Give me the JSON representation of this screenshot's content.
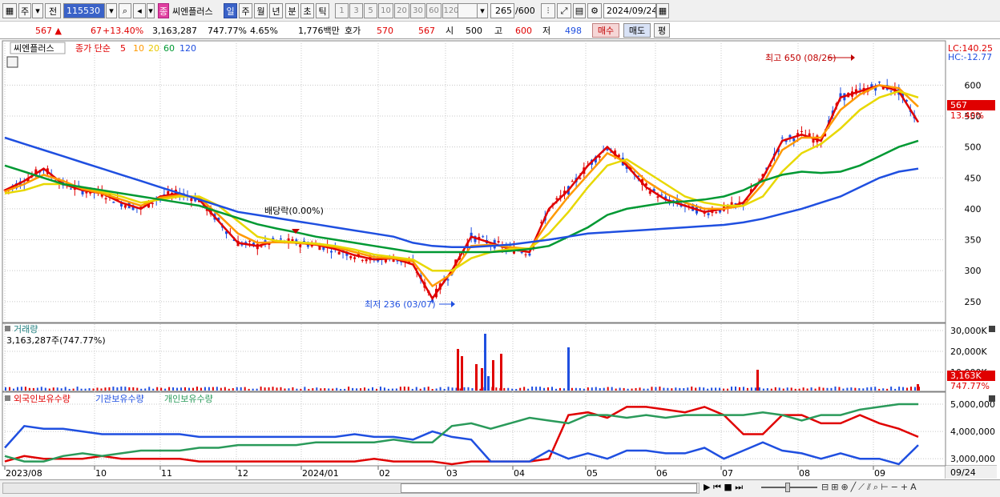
{
  "toolbar": {
    "market_btn": "주",
    "prev_btn": "전",
    "stock_code": "115530",
    "tag_label": "종",
    "stock_name": "씨엔플러스",
    "periods": [
      "일",
      "주",
      "월",
      "년",
      "분",
      "초",
      "틱"
    ],
    "active_period": "일",
    "minutes": [
      "1",
      "3",
      "5",
      "10",
      "20",
      "30",
      "60",
      "120"
    ],
    "count": "265",
    "count_total": "/600",
    "date": "2024/09/24"
  },
  "quote": {
    "price": "567",
    "change": "67",
    "change_pct": "+13.40%",
    "volume": "3,163,287",
    "vol_ratio": "747.77%",
    "turnover": "4.65%",
    "amount": "1,776백만",
    "hoga_label": "호가",
    "ask": "570",
    "bid": "567",
    "open_label": "시",
    "open": "500",
    "high_label": "고",
    "high": "600",
    "low_label": "저",
    "low": "498",
    "buy_btn": "매수",
    "sell_btn": "매도",
    "eval_btn": "평"
  },
  "price_panel": {
    "stock_tag": "씨엔플러스",
    "ma_label": "종가 단순",
    "ma_periods": [
      "5",
      "10",
      "20",
      "60",
      "120"
    ],
    "ma_colors": [
      "#e00000",
      "#ff9900",
      "#e8d800",
      "#009933",
      "#1f4fe0"
    ],
    "lc": "LC:140.25",
    "hc": "HC:-12.77",
    "cur_price_tag": "567",
    "cur_pct_tag": "13.40%",
    "high_note": "최고 650 (08/26)",
    "low_note": "최저 236 (03/07)",
    "dividend_note": "배당락(0.00%)",
    "y_ticks": [
      "600",
      "550",
      "500",
      "450",
      "400",
      "350",
      "300",
      "250"
    ]
  },
  "volume_panel": {
    "title": "거래량",
    "value": "3,163,287주(747.77%)",
    "y_ticks": [
      "30,000K",
      "20,000K",
      "10,000K"
    ],
    "cur_tag": "3,163K",
    "cur_pct": "747.77%"
  },
  "holdings_panel": {
    "legend": [
      "외국인보유수량",
      "기관보유수량",
      "개인보유수량"
    ],
    "colors": [
      "#e00000",
      "#1f4fe0",
      "#2a9a5a"
    ],
    "y_ticks": [
      "5,000,000",
      "4,000,000",
      "3,000,000"
    ]
  },
  "x_axis": {
    "labels": [
      "2023/08",
      "10",
      "11",
      "12",
      "2024/01",
      "02",
      "03",
      "04",
      "05",
      "06",
      "07",
      "08",
      "09"
    ],
    "end_label": "09/24"
  },
  "chart_data": {
    "type": "line",
    "price_range": [
      220,
      660
    ],
    "moving_averages": [
      {
        "name": "5",
        "color": "#e00000",
        "values": [
          430,
          445,
          465,
          440,
          430,
          425,
          410,
          400,
          420,
          425,
          415,
          380,
          345,
          340,
          348,
          345,
          342,
          335,
          325,
          318,
          320,
          310,
          255,
          300,
          355,
          345,
          335,
          330,
          400,
          430,
          470,
          500,
          470,
          435,
          415,
          405,
          395,
          400,
          410,
          450,
          510,
          520,
          510,
          580,
          590,
          600,
          590,
          540
        ]
      },
      {
        "name": "10",
        "color": "#ff9900",
        "values": [
          428,
          440,
          455,
          445,
          432,
          425,
          415,
          405,
          418,
          422,
          418,
          390,
          360,
          345,
          346,
          345,
          343,
          338,
          330,
          322,
          320,
          315,
          275,
          295,
          340,
          342,
          338,
          335,
          380,
          420,
          455,
          490,
          475,
          445,
          425,
          410,
          400,
          400,
          405,
          440,
          495,
          515,
          515,
          560,
          585,
          600,
          595,
          565
        ]
      },
      {
        "name": "20",
        "color": "#e8d800",
        "values": [
          425,
          430,
          440,
          440,
          435,
          428,
          420,
          410,
          415,
          420,
          420,
          405,
          380,
          355,
          348,
          346,
          344,
          340,
          334,
          326,
          322,
          318,
          300,
          300,
          320,
          330,
          335,
          336,
          360,
          395,
          435,
          470,
          480,
          460,
          440,
          420,
          410,
          405,
          405,
          420,
          460,
          490,
          505,
          530,
          560,
          580,
          590,
          580
        ]
      },
      {
        "name": "60",
        "color": "#009933",
        "values": [
          470,
          460,
          450,
          440,
          435,
          430,
          425,
          420,
          415,
          410,
          405,
          395,
          385,
          375,
          368,
          362,
          355,
          350,
          345,
          340,
          335,
          330,
          330,
          330,
          330,
          330,
          332,
          335,
          340,
          355,
          370,
          390,
          400,
          405,
          410,
          412,
          415,
          420,
          430,
          445,
          455,
          460,
          458,
          460,
          470,
          485,
          500,
          510
        ]
      },
      {
        "name": "120",
        "color": "#1f4fe0",
        "values": [
          515,
          505,
          495,
          485,
          475,
          465,
          455,
          445,
          435,
          425,
          415,
          405,
          395,
          390,
          385,
          380,
          375,
          370,
          365,
          360,
          355,
          345,
          340,
          338,
          338,
          340,
          342,
          346,
          350,
          355,
          360,
          362,
          364,
          366,
          368,
          370,
          372,
          374,
          378,
          384,
          392,
          400,
          410,
          420,
          435,
          450,
          460,
          465
        ]
      }
    ],
    "holdings_series": [
      {
        "name": "외국인보유수량",
        "values": [
          2.9,
          3.1,
          3.0,
          3.0,
          3.0,
          3.1,
          3.0,
          3.0,
          3.0,
          3.0,
          2.9,
          2.9,
          2.9,
          2.9,
          2.9,
          2.9,
          2.9,
          2.9,
          2.9,
          3.0,
          2.9,
          2.9,
          2.9,
          2.8,
          2.9,
          2.9,
          2.9,
          2.9,
          3.0,
          4.6,
          4.7,
          4.5,
          4.9,
          4.9,
          4.8,
          4.7,
          4.9,
          4.6,
          3.9,
          3.9,
          4.6,
          4.6,
          4.3,
          4.3,
          4.6,
          4.3,
          4.1,
          3.8
        ]
      },
      {
        "name": "기관보유수량",
        "values": [
          3.4,
          4.2,
          4.1,
          4.1,
          4.0,
          3.9,
          3.9,
          3.9,
          3.9,
          3.9,
          3.8,
          3.8,
          3.8,
          3.8,
          3.8,
          3.8,
          3.8,
          3.8,
          3.9,
          3.8,
          3.8,
          3.7,
          4.0,
          3.8,
          3.7,
          2.9,
          2.9,
          2.9,
          3.3,
          3.0,
          3.2,
          3.0,
          3.3,
          3.3,
          3.2,
          3.2,
          3.4,
          3.0,
          3.3,
          3.6,
          3.3,
          3.2,
          3.0,
          3.2,
          3.0,
          3.0,
          2.8,
          3.5
        ]
      },
      {
        "name": "개인보유수량",
        "values": [
          3.1,
          2.9,
          2.9,
          3.1,
          3.2,
          3.1,
          3.2,
          3.3,
          3.3,
          3.3,
          3.4,
          3.4,
          3.5,
          3.5,
          3.5,
          3.5,
          3.6,
          3.6,
          3.6,
          3.6,
          3.7,
          3.6,
          3.6,
          4.2,
          4.3,
          4.1,
          4.3,
          4.5,
          4.4,
          4.3,
          4.6,
          4.6,
          4.5,
          4.6,
          4.5,
          4.6,
          4.6,
          4.6,
          4.6,
          4.7,
          4.6,
          4.4,
          4.6,
          4.6,
          4.8,
          4.9,
          5.0,
          5.0
        ]
      }
    ]
  }
}
